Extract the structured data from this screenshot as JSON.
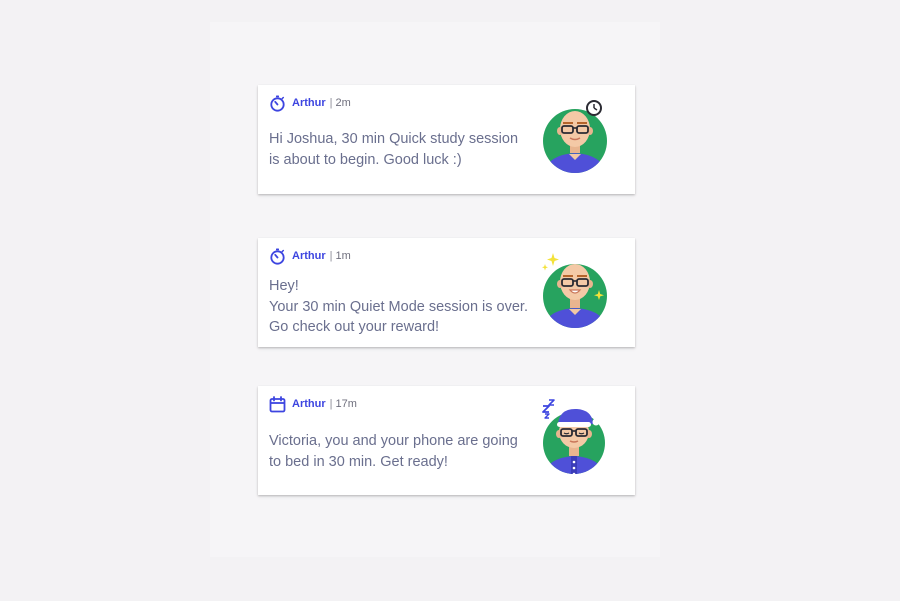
{
  "colors": {
    "background": "#f3f2f4",
    "card": "#ffffff",
    "accent": "#3d45e0",
    "message_text": "#6a6f8e",
    "avatar_ring": "#27a35f",
    "shirt": "#4f50d8"
  },
  "notifications": [
    {
      "icon": "stopwatch-icon",
      "sender": "Arthur",
      "separator": "|",
      "time": "2m",
      "message_lines": [
        "Hi Joshua, 30 min Quick study session",
        "is about to begin. Good luck :)"
      ],
      "avatar": "arthur-clock-avatar"
    },
    {
      "icon": "stopwatch-icon",
      "sender": "Arthur",
      "separator": "|",
      "time": "1m",
      "message_lines": [
        "Hey!",
        "Your 30 min Quiet Mode session is over.",
        "Go check out your reward!"
      ],
      "avatar": "arthur-sparkle-avatar"
    },
    {
      "icon": "calendar-icon",
      "sender": "Arthur",
      "separator": "|",
      "time": "17m",
      "message_lines": [
        "Victoria, you and your phone are going",
        "to bed in 30 min. Get ready!"
      ],
      "avatar": "arthur-sleeping-avatar"
    }
  ]
}
